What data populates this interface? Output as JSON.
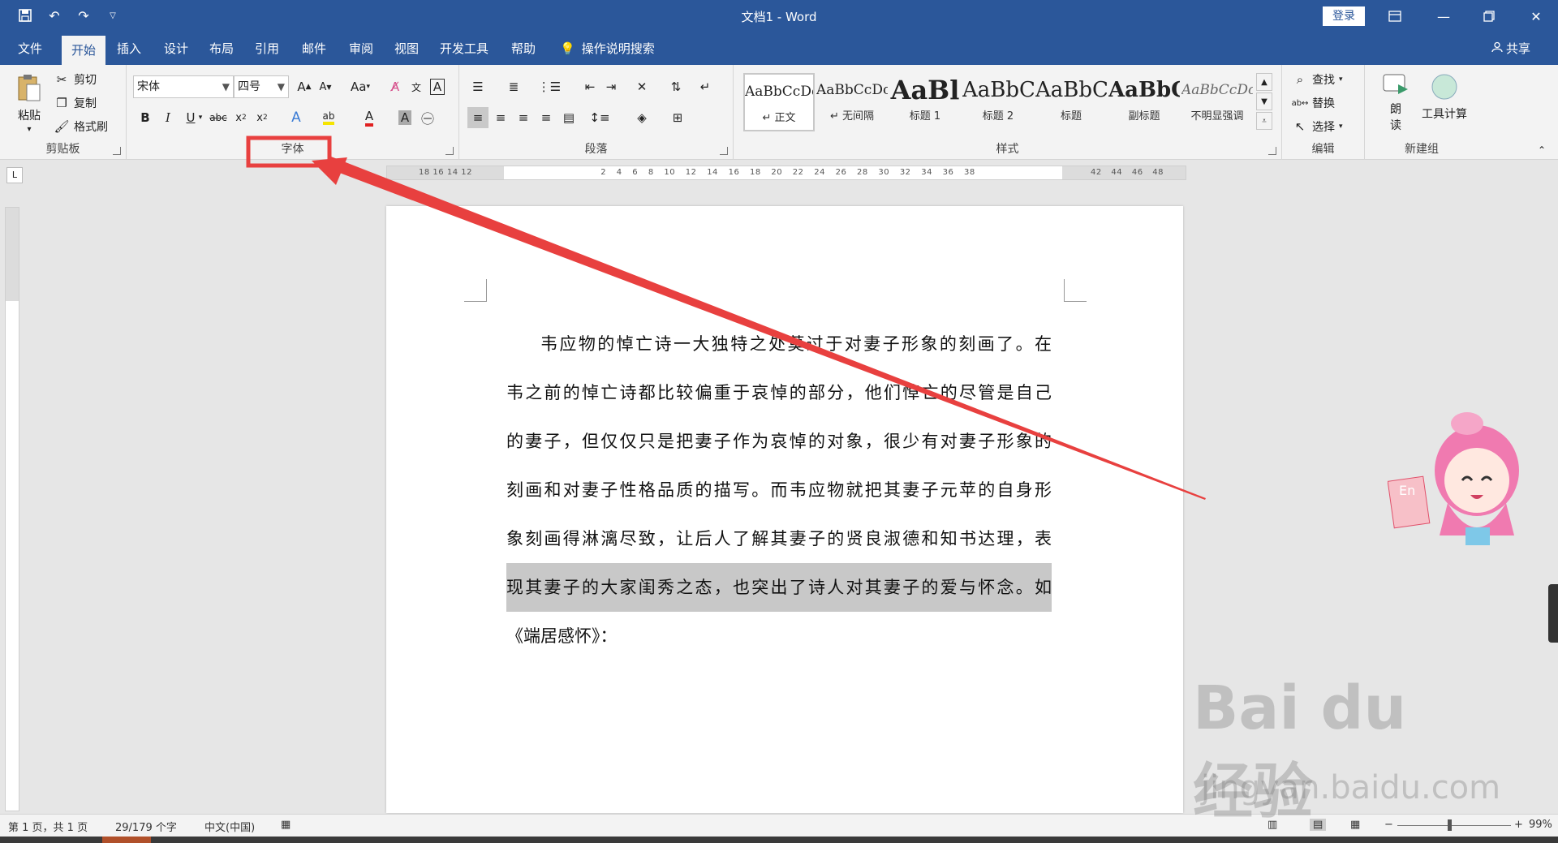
{
  "window": {
    "title": "文档1 - Word",
    "login_label": "登录",
    "qat_icons": [
      "save-icon",
      "undo-icon",
      "redo-icon",
      "customize-icon"
    ]
  },
  "tabs": [
    {
      "label": "文件"
    },
    {
      "label": "开始"
    },
    {
      "label": "插入"
    },
    {
      "label": "设计"
    },
    {
      "label": "布局"
    },
    {
      "label": "引用"
    },
    {
      "label": "邮件"
    },
    {
      "label": "审阅"
    },
    {
      "label": "视图"
    },
    {
      "label": "开发工具"
    },
    {
      "label": "帮助"
    }
  ],
  "tell_me": "操作说明搜索",
  "share": "共享",
  "clipboard": {
    "paste": "粘贴",
    "cut": "剪切",
    "copy": "复制",
    "format_painter": "格式刷",
    "label": "剪贴板"
  },
  "font": {
    "name": "宋体",
    "size": "四号",
    "label": "字体",
    "change_case": "Aa"
  },
  "paragraph": {
    "label": "段落"
  },
  "styles": {
    "label": "样式",
    "items": [
      {
        "sample": "AaBbCcDc",
        "name": "正文"
      },
      {
        "sample": "AaBbCcDc",
        "name": "无间隔"
      },
      {
        "sample": "AaBl",
        "name": "标题 1"
      },
      {
        "sample": "AaBbC",
        "name": "标题 2"
      },
      {
        "sample": "AaBbC",
        "name": "标题"
      },
      {
        "sample": "AaBbC",
        "name": "副标题"
      },
      {
        "sample": "AaBbCcDc",
        "name": "不明显强调"
      }
    ]
  },
  "editing": {
    "find": "查找",
    "replace": "替换",
    "select": "选择",
    "label": "编辑"
  },
  "newgroup": {
    "read_top": "朗",
    "read_bottom": "读",
    "calc": "工具计算",
    "label": "新建组"
  },
  "ruler": {
    "h_left": "18 16 14 12",
    "h_main": "2 4 6 8 10 12 14 16 18 20 22 24 26 28 30 32 34 36 38",
    "h_right": "42 44 46 48",
    "corner": "L"
  },
  "document": {
    "lines": [
      "韦应物的悼亡诗一大独特之处莫过于对妻子形象的刻画了。在",
      "韦之前的悼亡诗都比较偏重于哀悼的部分，他们悼亡的尽管是自己",
      "的妻子，但仅仅只是把妻子作为哀悼的对象，很少有对妻子形象的",
      "刻画和对妻子性格品质的描写。而韦应物就把其妻子元苹的自身形",
      "象刻画得淋漓尽致，让后人了解其妻子的贤良淑德和知书达理，表",
      "现其妻子的大家闺秀之态，也突出了诗人对其妻子的爱与怀念。如",
      "《端居感怀》："
    ]
  },
  "status": {
    "page": "第 1 页，共 1 页",
    "words": "29/179 个字",
    "language": "中文(中国)",
    "zoom": "99%"
  },
  "watermark": {
    "logo": "Bai du 经验",
    "url": "jingyan.baidu.com"
  },
  "colors": {
    "brand": "#2b579a",
    "annotation": "#e8403f",
    "highlight": "#c8c8c8"
  }
}
